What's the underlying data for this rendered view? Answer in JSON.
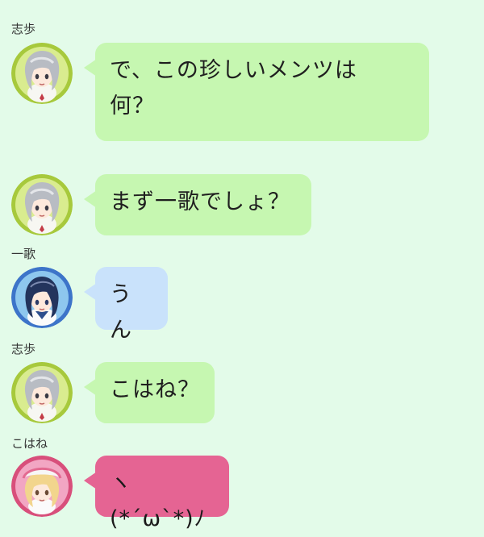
{
  "colors": {
    "background": "#e3fbe9",
    "bubble_green": "#c6f7b1",
    "bubble_blue": "#c9e2fb",
    "bubble_pink": "#e56493"
  },
  "messages": [
    {
      "sender": "志歩",
      "text_line1": "で、この珍しいメンツは",
      "text_line2": "何？",
      "avatar": "shiho-avatar"
    },
    {
      "sender": "",
      "text": "まず一歌でしょ？",
      "avatar": "shiho-avatar"
    },
    {
      "sender": "一歌",
      "text": "うん",
      "avatar": "ichika-avatar"
    },
    {
      "sender": "志歩",
      "text": "こはね？",
      "avatar": "shiho-avatar"
    },
    {
      "sender": "こはね",
      "text": "ヽ(*ˊωˋ*)ﾉ",
      "avatar": "kohane-avatar"
    }
  ]
}
